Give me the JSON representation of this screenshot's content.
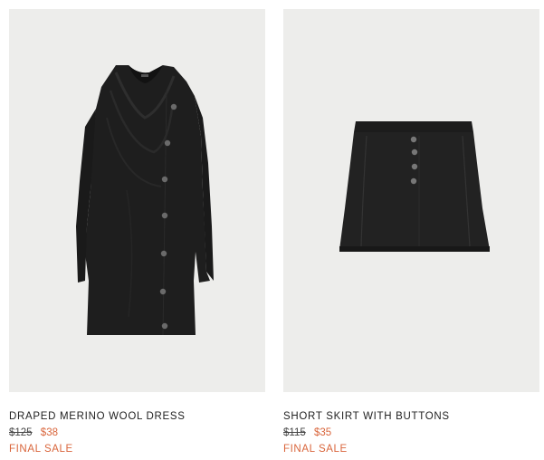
{
  "products": [
    {
      "name": "DRAPED MERINO WOOL DRESS",
      "old_price": "$125",
      "new_price": "$38",
      "tag": "FINAL SALE",
      "image": "black-draped-dress-image"
    },
    {
      "name": "SHORT SKIRT WITH BUTTONS",
      "old_price": "$115",
      "new_price": "$35",
      "tag": "FINAL SALE",
      "image": "black-short-skirt-image"
    }
  ],
  "colors": {
    "image_background": "#ededeb",
    "garment": "#1e1e1e",
    "sale_accent": "#d9653b",
    "text": "#222222"
  }
}
